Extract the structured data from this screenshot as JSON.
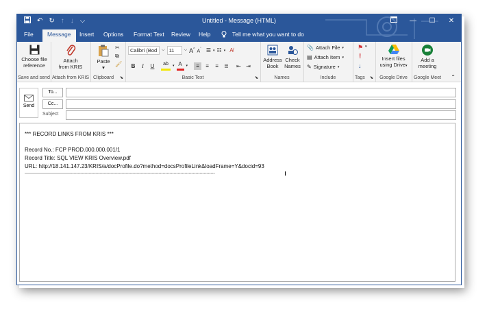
{
  "window": {
    "title": "Untitled  -  Message (HTML)",
    "controls": {
      "restore": "▢",
      "minimize": "—",
      "maximize": "☐",
      "close": "✕"
    }
  },
  "quick_access": {
    "save": "💾",
    "undo": "↶",
    "redo": "↻",
    "up": "↑",
    "down": "↓",
    "customize": "⌵"
  },
  "tabs": [
    {
      "label": "File"
    },
    {
      "label": "Message"
    },
    {
      "label": "Insert"
    },
    {
      "label": "Options"
    },
    {
      "label": "Format Text"
    },
    {
      "label": "Review"
    },
    {
      "label": "Help"
    }
  ],
  "tell_me": "Tell me what you want to do",
  "ribbon": {
    "save_send": {
      "choose_file": "Choose file",
      "reference": "reference",
      "group": "Save and send"
    },
    "attach_kris": {
      "line1": "Attach",
      "line2": "from KRIS",
      "group": "Attach from KRIS"
    },
    "clipboard": {
      "paste": "Paste",
      "group": "Clipboard"
    },
    "basic_text": {
      "font": "Calibri (Body)",
      "font_short": "Calibri (Bod",
      "size": "11",
      "grow": "A",
      "shrink": "A",
      "bold": "B",
      "italic": "I",
      "underline": "U",
      "highlight": "ab",
      "font_color": "A",
      "group": "Basic Text"
    },
    "names": {
      "address": "Address",
      "book": "Book",
      "check": "Check",
      "names": "Names",
      "group": "Names"
    },
    "include": {
      "attach_file": "Attach File",
      "attach_item": "Attach Item",
      "signature": "Signature",
      "group": "Include"
    },
    "tags": {
      "group": "Tags"
    },
    "google_drive": {
      "line1": "Insert files",
      "line2": "using Drive",
      "group": "Google Drive"
    },
    "google_meet": {
      "line1": "Add a",
      "line2": "meeting",
      "group": "Google Meet"
    }
  },
  "header": {
    "send": "Send",
    "to": "To...",
    "cc": "Cc...",
    "subject": "Subject"
  },
  "body": {
    "line1": "*** RECORD LINKS FROM KRIS ***",
    "line2": "Record No.: FCP PROD.000.000.001/1",
    "line3": "Record Title: SQL VIEW KRIS Overview.pdf",
    "line4": "URL: http://18.141.147.23/KRIS/a/docProfile.do?method=docsProfileLink&loadFrame=Y&docid=93",
    "line5": "-------------------------------------------------------------------------------------------------------------------------------------------"
  },
  "colors": {
    "accent": "#2b579a",
    "ribbon": "#f3f3f3"
  }
}
